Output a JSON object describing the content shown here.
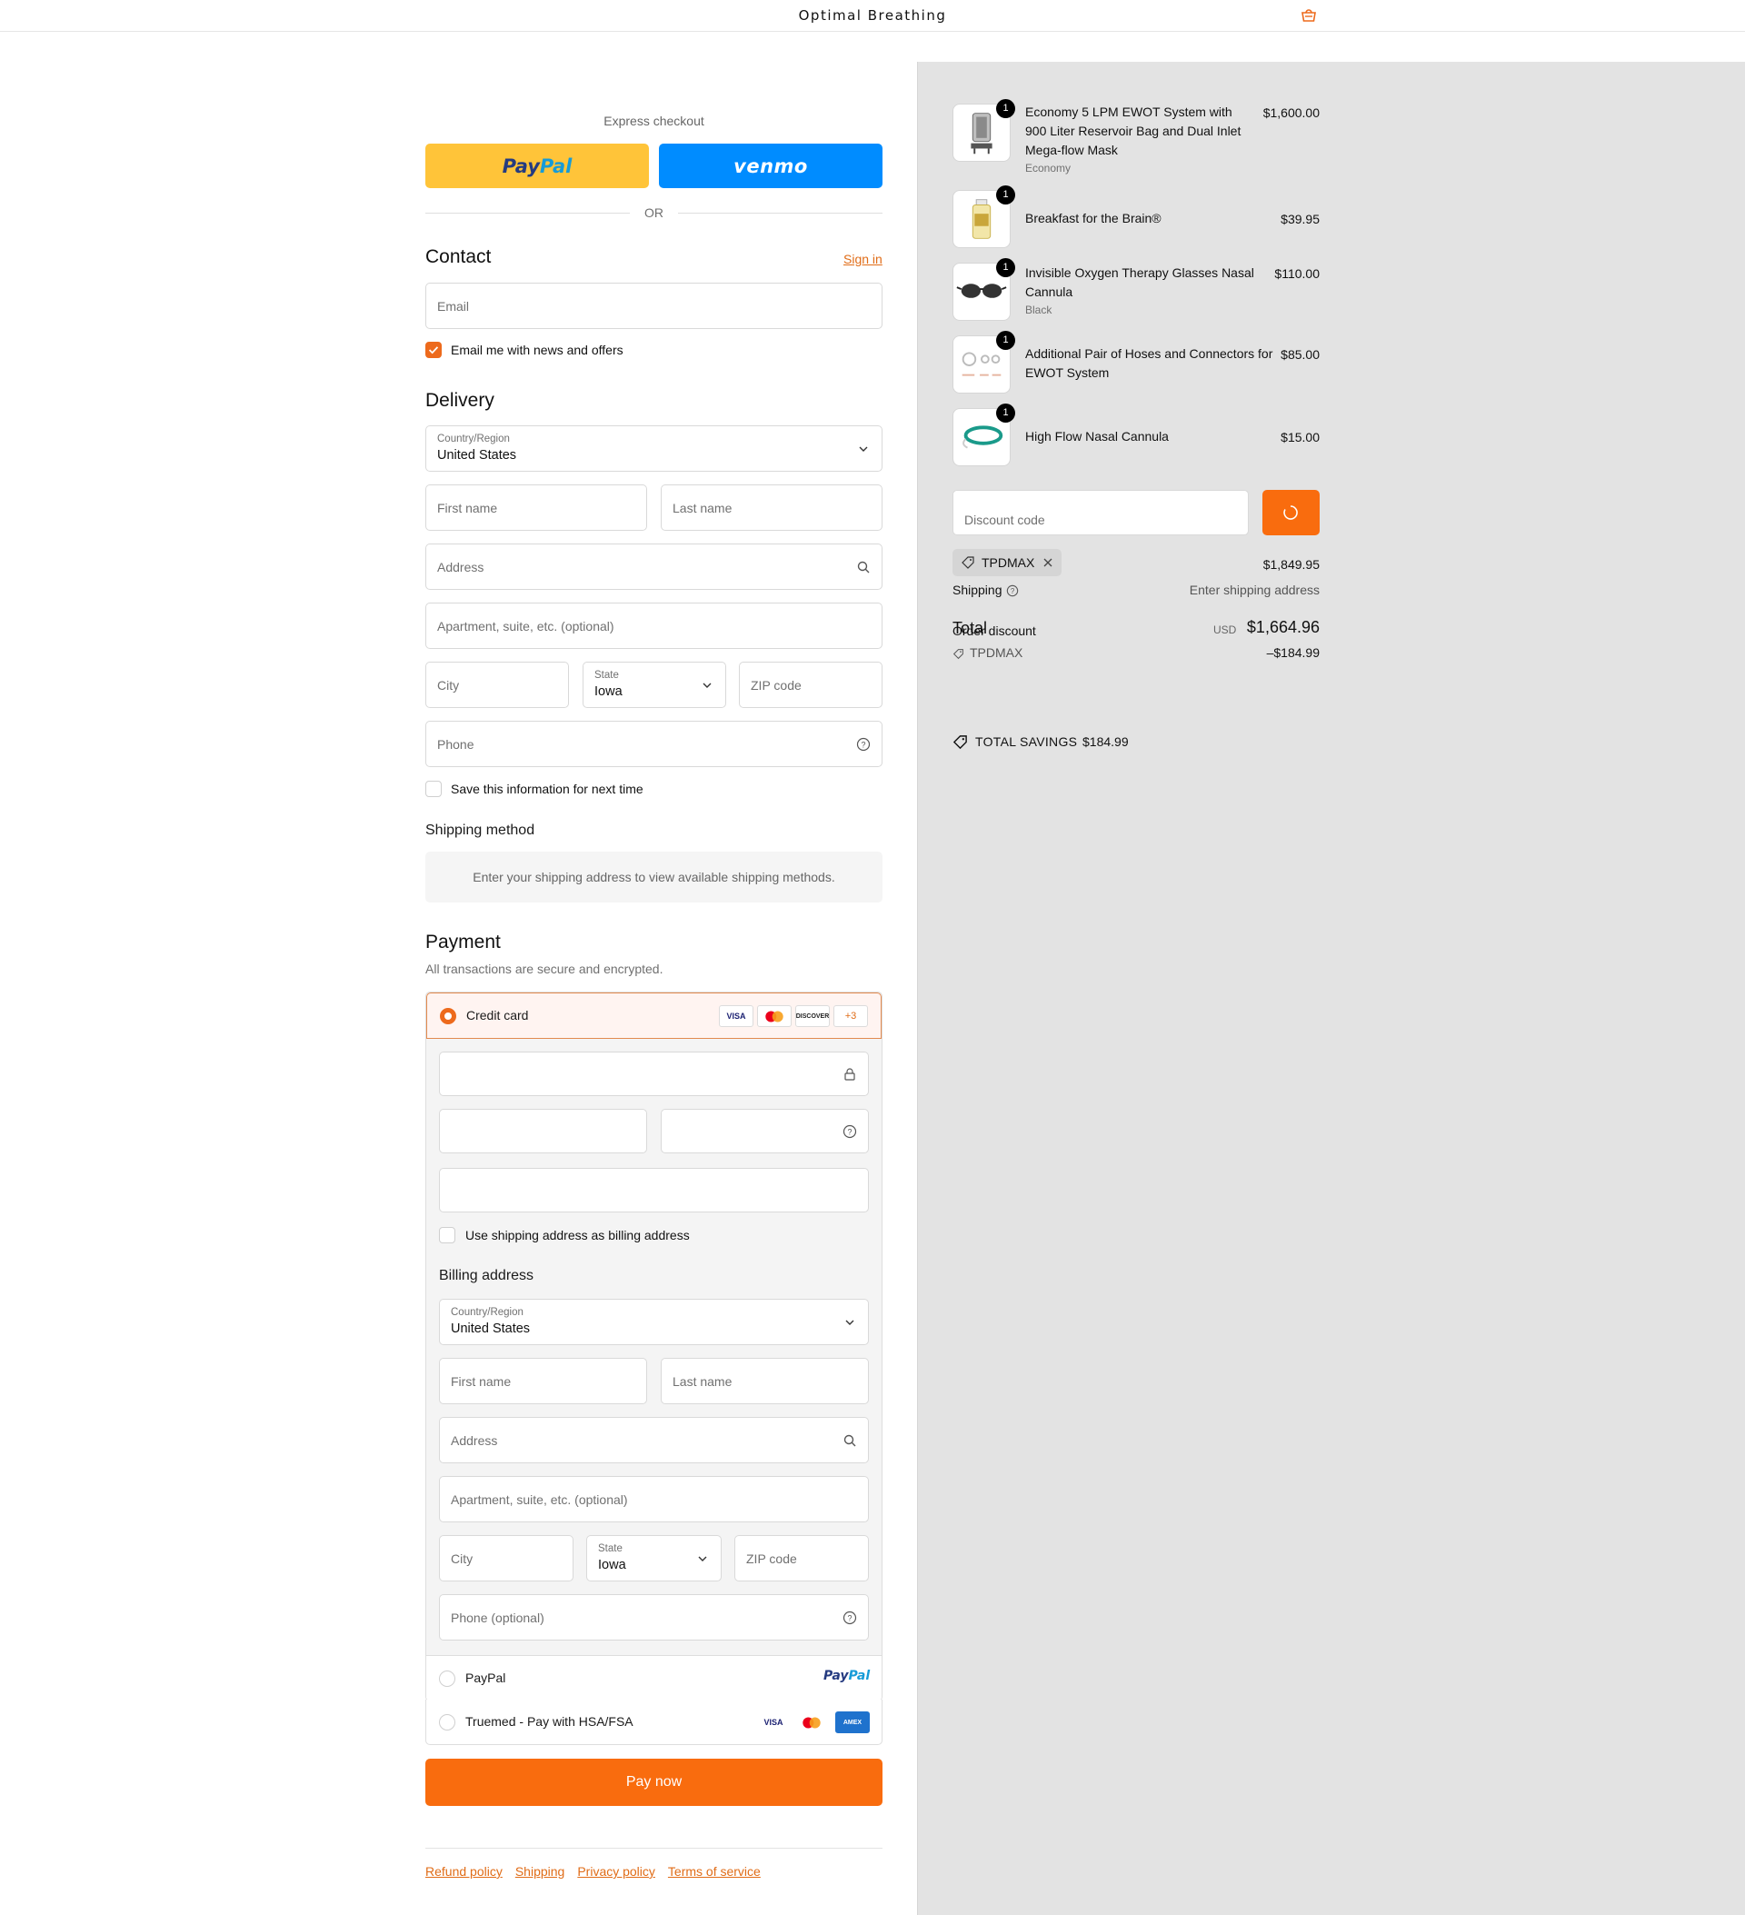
{
  "header": {
    "brand": "Optimal Breathing",
    "cart_icon": "bag-icon",
    "accent": "#ED6A1C"
  },
  "express": {
    "label": "Express checkout",
    "paypal": {
      "pay": "Pay",
      "pal": "Pal"
    },
    "venmo": "venmo",
    "or": "OR"
  },
  "contact": {
    "title": "Contact",
    "sign_in": "Sign in",
    "email_placeholder": "Email",
    "news_label": "Email me with news and offers",
    "news_checked": true
  },
  "delivery": {
    "title": "Delivery",
    "country_label": "Country/Region",
    "country_value": "United States",
    "first_name": "First name",
    "last_name": "Last name",
    "address": "Address",
    "apartment": "Apartment, suite, etc. (optional)",
    "city": "City",
    "state_label": "State",
    "state_value": "Iowa",
    "zip": "ZIP code",
    "phone": "Phone",
    "save_label": "Save this information for next time"
  },
  "shipping_method": {
    "title": "Shipping method",
    "info": "Enter your shipping address to view available shipping methods."
  },
  "payment": {
    "title": "Payment",
    "subtitle": "All transactions are secure and encrypted.",
    "credit_card": "Credit card",
    "cards": [
      "VISA",
      "mastercard",
      "DISCOVER",
      "+3"
    ],
    "use_shipping_label": "Use shipping address as billing address",
    "billing_title": "Billing address",
    "billing": {
      "country_label": "Country/Region",
      "country_value": "United States",
      "first_name": "First name",
      "last_name": "Last name",
      "address": "Address",
      "apartment": "Apartment, suite, etc. (optional)",
      "city": "City",
      "state_label": "State",
      "state_value": "Iowa",
      "zip": "ZIP code",
      "phone": "Phone (optional)"
    },
    "paypal_option": "PayPal",
    "paypal_logo": {
      "pay": "Pay",
      "pal": "Pal"
    },
    "truemed_option": "Truemed - Pay with HSA/FSA",
    "truemed_cards": [
      "VISA",
      "mastercard",
      "AMEX"
    ],
    "pay_now": "Pay now"
  },
  "footer": {
    "links": [
      "Refund policy",
      "Shipping",
      "Privacy policy",
      "Terms of service"
    ]
  },
  "summary": {
    "items": [
      {
        "name_lines": [
          "Economy 5 LPM EWOT System with",
          "900 Liter Reservoir Bag and Dual Inlet",
          "Mega-flow Mask"
        ],
        "variant": "Economy",
        "price": "$1,600.00",
        "qty": "1"
      },
      {
        "name_lines": [
          "Breakfast for the Brain®"
        ],
        "variant": "",
        "price": "$39.95",
        "qty": "1"
      },
      {
        "name_lines": [
          "Invisible Oxygen Therapy Glasses Nasal",
          "Cannula"
        ],
        "variant": "Black",
        "price": "$110.00",
        "qty": "1"
      },
      {
        "name_lines": [
          "Additional Pair of Hoses and Connectors for",
          "EWOT System"
        ],
        "variant": "",
        "price": "$85.00",
        "qty": "1"
      },
      {
        "name_lines": [
          "High Flow Nasal Cannula"
        ],
        "variant": "",
        "price": "$15.00",
        "qty": "1"
      }
    ],
    "discount_placeholder": "Discount code",
    "applied_code": "TPDMAX",
    "subtotal_value": "$1,849.95",
    "shipping_label": "Shipping",
    "shipping_value": "Enter shipping address",
    "total_label": "Total",
    "order_discount_label": "Order discount",
    "currency": "USD",
    "total_value": "$1,664.96",
    "discount_code_line": "TPDMAX",
    "discount_value": "–$184.99",
    "savings_label": "TOTAL SAVINGS",
    "savings_value": "$184.99"
  }
}
